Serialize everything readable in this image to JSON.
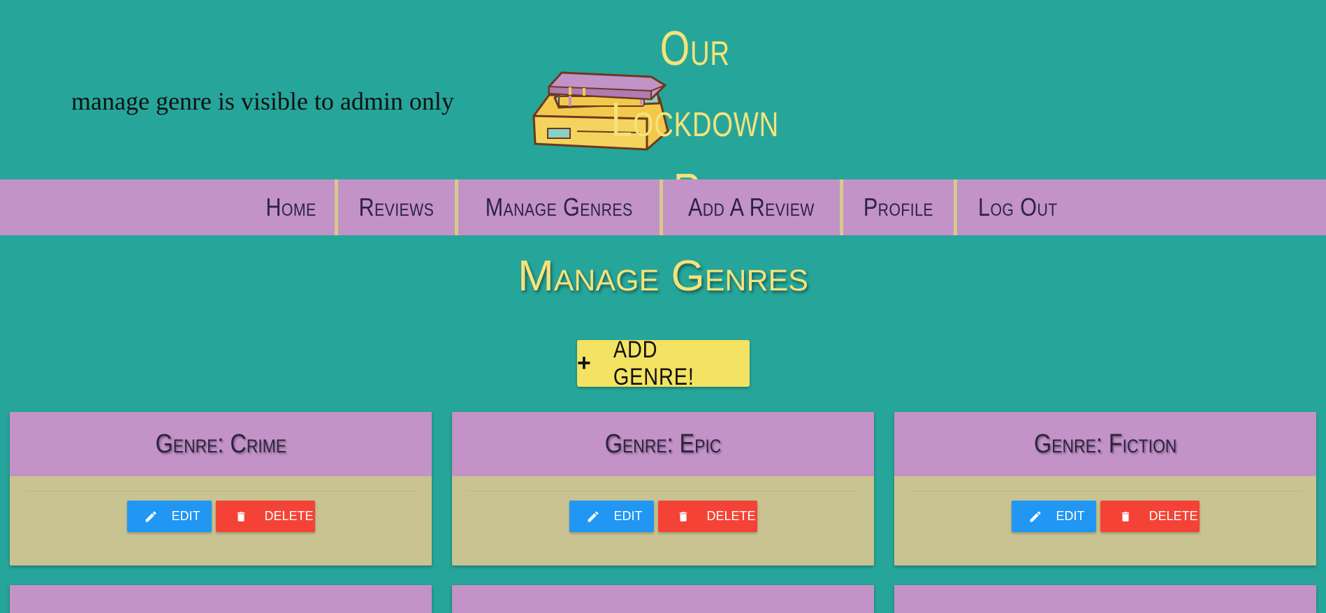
{
  "header": {
    "admin_note": "manage genre is visible to admin only",
    "site_title_line1": "Our Lockdown",
    "site_title_line2": "Reads"
  },
  "nav": {
    "items": [
      {
        "label": "Home"
      },
      {
        "label": "Reviews"
      },
      {
        "label": "Manage Genres"
      },
      {
        "label": "Add A Review"
      },
      {
        "label": "Profile"
      },
      {
        "label": "Log Out"
      }
    ]
  },
  "main": {
    "page_title": "Manage Genres",
    "add_button_label": "ADD GENRE!",
    "add_button_icon": "plus-icon",
    "genres": [
      {
        "title": "Genre: Crime",
        "edit_label": "EDIT",
        "delete_label": "DELETE"
      },
      {
        "title": "Genre: Epic",
        "edit_label": "EDIT",
        "delete_label": "DELETE"
      },
      {
        "title": "Genre: Fiction",
        "edit_label": "EDIT",
        "delete_label": "DELETE"
      }
    ]
  },
  "colors": {
    "background": "#26a69a",
    "accent_purple": "#c392c7",
    "accent_yellow": "#f6e27a",
    "card_body": "#c8c390",
    "edit_blue": "#2196f3",
    "delete_red": "#f44336"
  }
}
